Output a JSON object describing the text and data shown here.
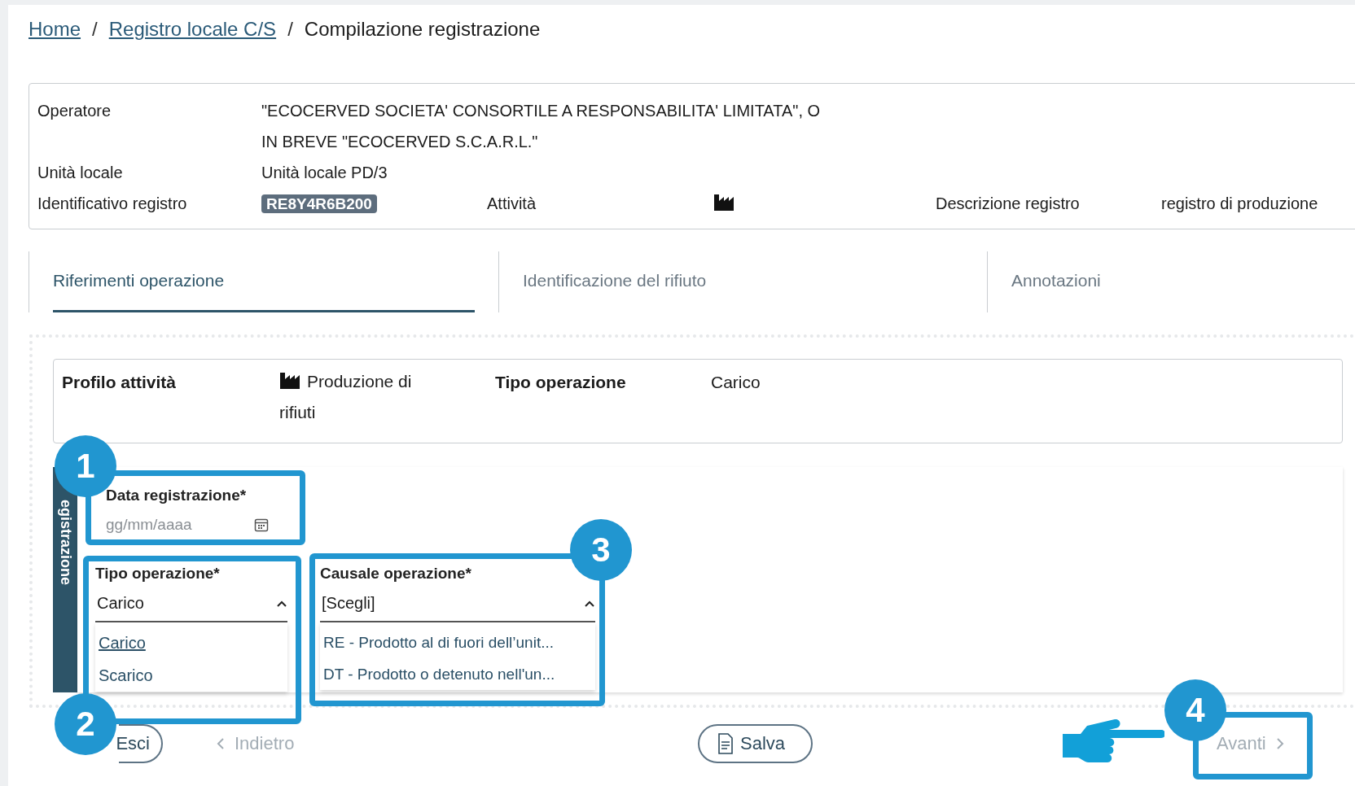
{
  "breadcrumb": [
    {
      "kind": "link",
      "label": "Home"
    },
    {
      "kind": "separator",
      "label": "/"
    },
    {
      "kind": "link",
      "label": "Registro locale C/S"
    },
    {
      "kind": "separator",
      "label": "/"
    },
    {
      "kind": "current",
      "label": "Compilazione registrazione"
    }
  ],
  "info_card": {
    "operatore_label": "Operatore",
    "operatore_lines": [
      "\"ECOCERVED SOCIETA' CONSORTILE A RESPONSABILITA' LIMITATA\", O",
      "IN BREVE \"ECOCERVED S.C.A.R.L.\""
    ],
    "unita_label": "Unità locale",
    "unita_value": "Unità locale PD/3",
    "id_label": "Identificativo registro",
    "id_value": "RE8Y4R6B200",
    "attivita_label": "Attività",
    "descrizione_label": "Descrizione registro",
    "descrizione_value": "registro di produzione"
  },
  "tabs": [
    {
      "label": "Riferimenti operazione",
      "selected": true
    },
    {
      "label": "Identificazione del rifiuto",
      "selected": false
    },
    {
      "label": "Annotazioni",
      "selected": false
    }
  ],
  "profile_card": {
    "profilo_label": "Profilo attività",
    "profilo_value": "Produzione di rifiuti",
    "tipo_label": "Tipo operazione",
    "tipo_value": "Carico"
  },
  "side_tab": {
    "label": "egistrazione"
  },
  "date_field": {
    "label": "Data registrazione*",
    "placeholder": "gg/mm/aaaa"
  },
  "tipo_select": {
    "label": "Tipo operazione*",
    "value": "Carico",
    "expanded": true,
    "options": [
      {
        "label": "Carico",
        "selected": true
      },
      {
        "label": "Scarico",
        "selected": false
      }
    ]
  },
  "causale_select": {
    "label": "Causale operazione*",
    "value": "[Scegli]",
    "expanded": true,
    "options": [
      {
        "label": "RE - Prodotto al di fuori dell’unit...",
        "selected": false
      },
      {
        "label": "DT - Prodotto o detenuto nell'un...",
        "selected": false
      }
    ]
  },
  "footer": {
    "esci": {
      "label": "Esci"
    },
    "indietro": {
      "label": "Indietro",
      "disabled": true
    },
    "salva": {
      "label": "Salva"
    },
    "avanti": {
      "label": "Avanti",
      "disabled": true
    }
  },
  "callouts": [
    {
      "number": "1"
    },
    {
      "number": "2"
    },
    {
      "number": "3"
    },
    {
      "number": "4"
    }
  ]
}
